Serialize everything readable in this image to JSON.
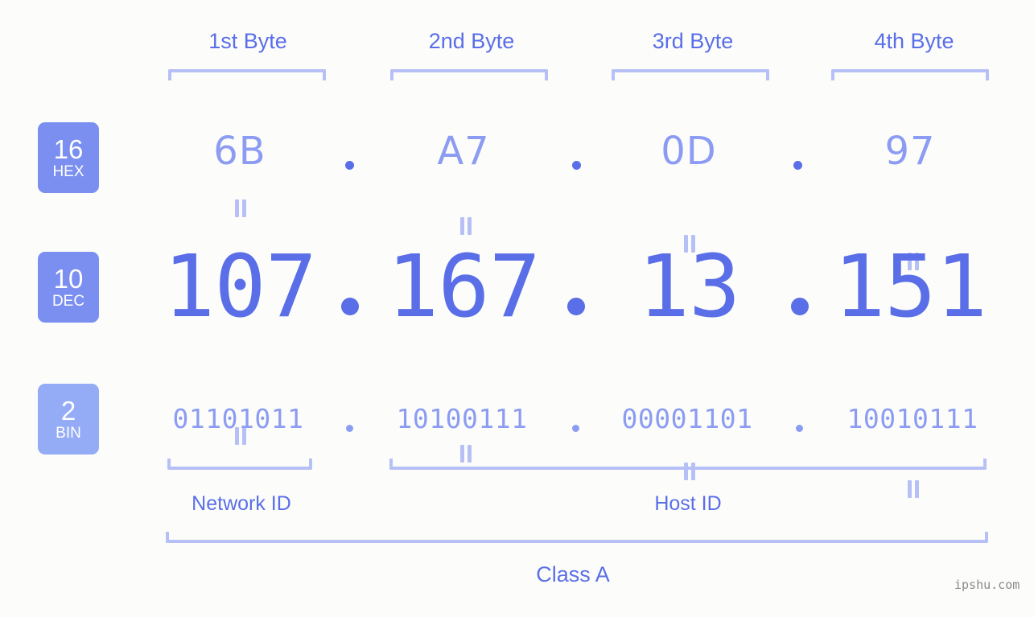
{
  "meta": {
    "watermark": "ipshu.com",
    "background_color": "#fcfdfa",
    "accent_strong": "#5a6ee8",
    "accent_light": "#8c9cf2",
    "accent_bracket": "#b6c0f7",
    "badge_color": "#7a8ff0",
    "badge_color_bin": "#94abf5"
  },
  "byte_headers": [
    {
      "label": "1st Byte"
    },
    {
      "label": "2nd Byte"
    },
    {
      "label": "3rd Byte"
    },
    {
      "label": "4th Byte"
    }
  ],
  "bases": [
    {
      "number": "16",
      "name": "HEX"
    },
    {
      "number": "10",
      "name": "DEC"
    },
    {
      "number": "2",
      "name": "BIN"
    }
  ],
  "rows": {
    "hex": {
      "base_number": "16",
      "base_name": "HEX",
      "values": [
        "6B",
        "A7",
        "0D",
        "97"
      ]
    },
    "dec": {
      "base_number": "10",
      "base_name": "DEC",
      "values": [
        "107",
        "167",
        "13",
        "151"
      ]
    },
    "bin": {
      "base_number": "2",
      "base_name": "BIN",
      "values": [
        "01101011",
        "10100111",
        "00001101",
        "10010111"
      ]
    }
  },
  "separators": {
    "dot": "."
  },
  "equals": {
    "symbol": "="
  },
  "sections": [
    {
      "label": "Network ID"
    },
    {
      "label": "Host ID"
    }
  ],
  "class": {
    "label": "Class A"
  }
}
